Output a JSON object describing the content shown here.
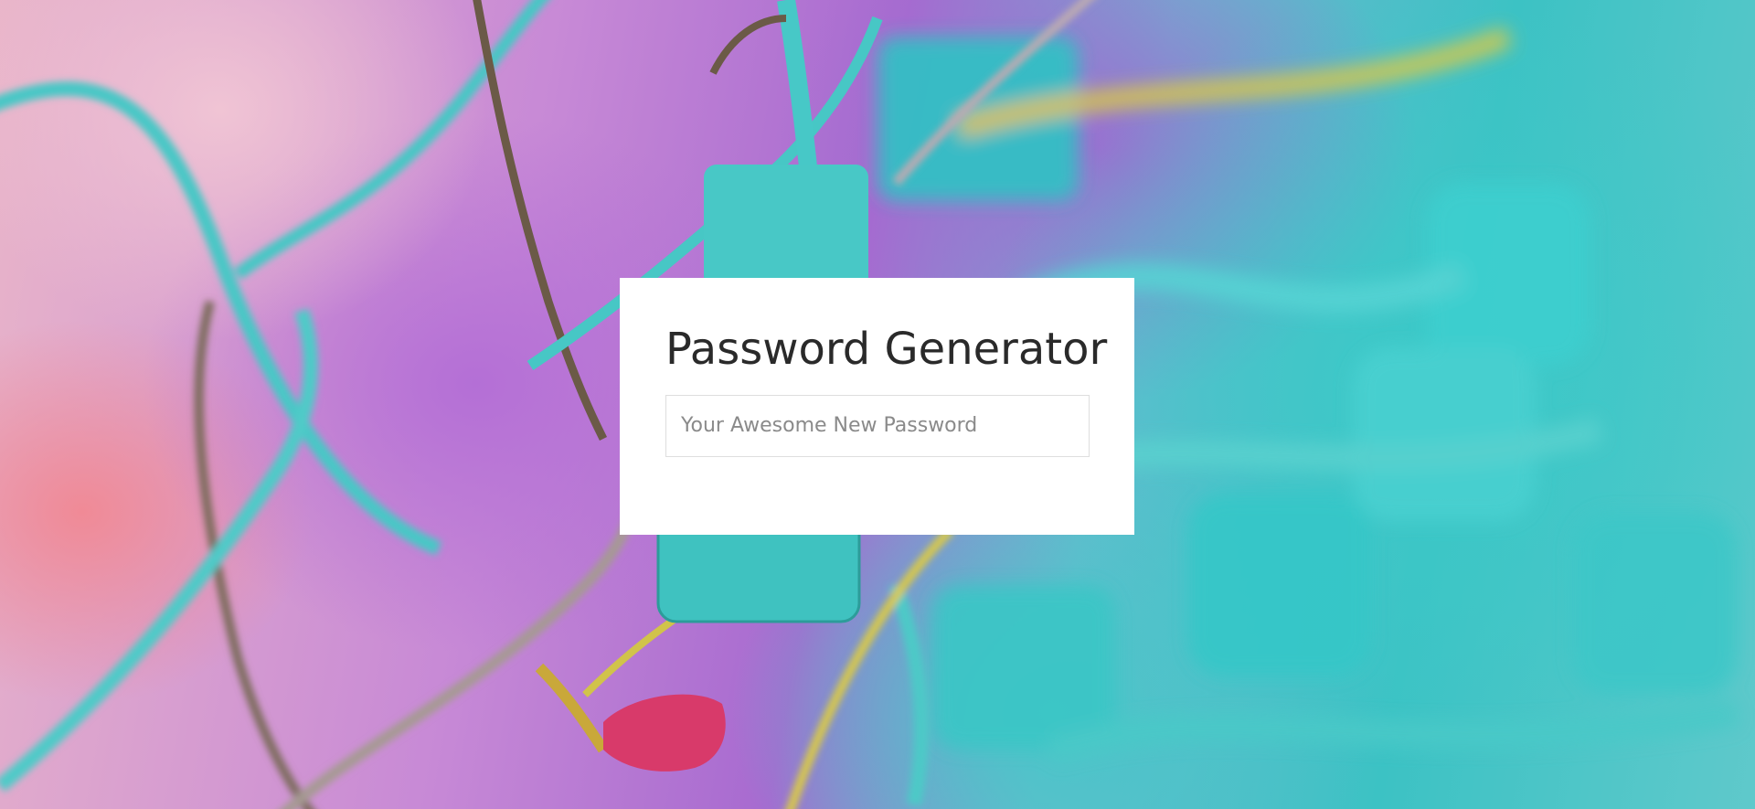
{
  "page": {
    "title": "Password Generator"
  },
  "background": {
    "subject": "padlocks-on-chain-link-fence-photo",
    "colors": {
      "pink": "#e9b5c9",
      "purple": "#a76ad0",
      "teal": "#3cc2c4",
      "yellow": "#d9c94a",
      "magenta": "#d83a6a"
    }
  },
  "card": {
    "title": "Password Generator",
    "password_input": {
      "value": "",
      "placeholder": "Your Awesome New Password"
    },
    "background_color": "#ffffff",
    "title_color": "#2a2a2a"
  }
}
